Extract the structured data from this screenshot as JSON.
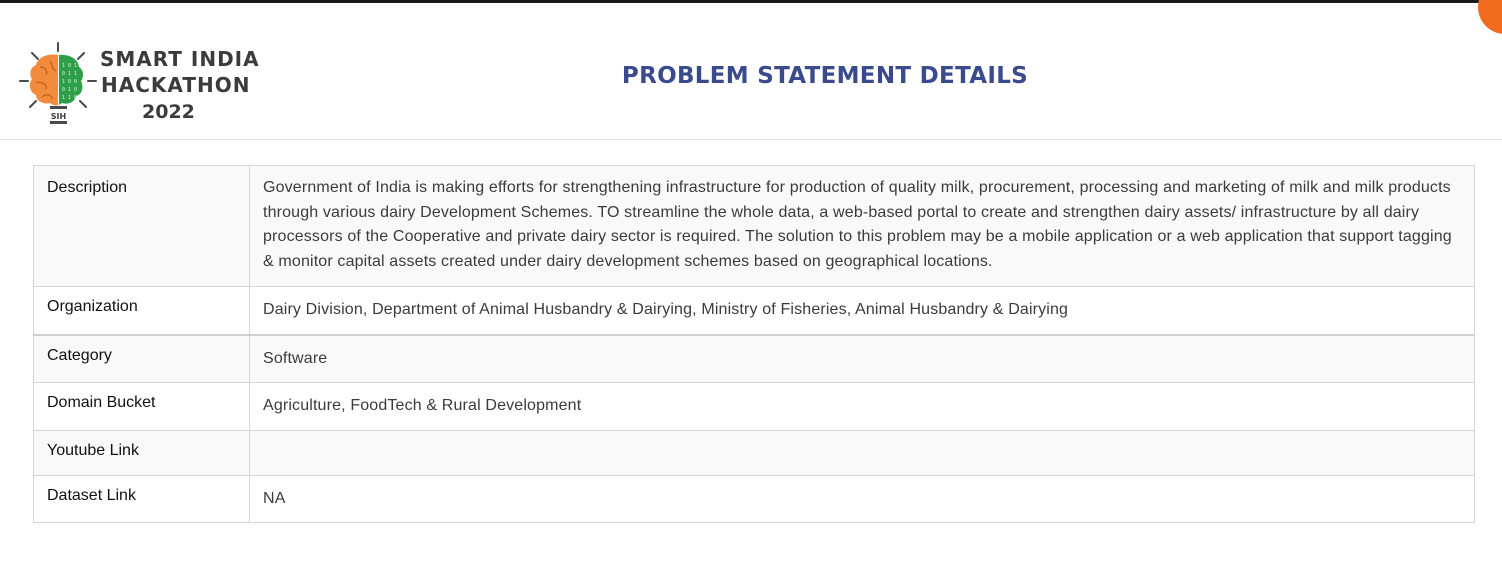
{
  "logo": {
    "line1": "SMART INDIA",
    "line2": "HACKATHON",
    "line3": "2022",
    "badge": "SIH",
    "colors": {
      "brain_left": "#f28b3c",
      "brain_right": "#2f9e49",
      "text": "#3b3b3b"
    }
  },
  "page_title": "PROBLEM STATEMENT DETAILS",
  "colors": {
    "title": "#3a4a8c",
    "accent_fab": "#f26b1d"
  },
  "details": {
    "rows": [
      {
        "label": "Description",
        "value": "Government of India is making efforts for strengthening infrastructure for production of quality milk, procurement, processing and marketing of milk and milk products through various dairy Development Schemes. TO streamline the whole data, a web-based portal to create and strengthen dairy assets/ infrastructure by all dairy processors of the Cooperative and private dairy sector is required. The solution to this problem may be a mobile application or a web application that support tagging & monitor capital assets created under dairy development schemes based on geographical locations."
      },
      {
        "label": "Organization",
        "value": "Dairy Division, Department of Animal Husbandry & Dairying, Ministry of Fisheries, Animal Husbandry & Dairying"
      },
      {
        "label": "Category",
        "value": "Software"
      },
      {
        "label": "Domain Bucket",
        "value": "Agriculture, FoodTech & Rural Development"
      },
      {
        "label": "Youtube Link",
        "value": ""
      },
      {
        "label": "Dataset Link",
        "value": "NA"
      }
    ]
  }
}
